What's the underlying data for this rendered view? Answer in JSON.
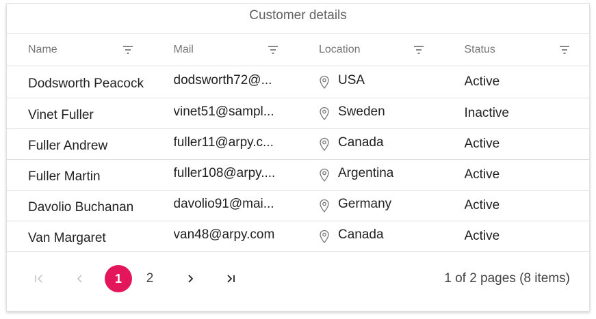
{
  "grid": {
    "title": "Customer details",
    "columns": [
      {
        "label": "Name"
      },
      {
        "label": "Mail"
      },
      {
        "label": "Location"
      },
      {
        "label": "Status"
      }
    ],
    "rows": [
      {
        "name": "Dodsworth Peacock",
        "mail": "dodsworth72@...",
        "location": "USA",
        "status": "Active"
      },
      {
        "name": "Vinet Fuller",
        "mail": "vinet51@sampl...",
        "location": "Sweden",
        "status": "Inactive"
      },
      {
        "name": "Fuller Andrew",
        "mail": "fuller11@arpy.c...",
        "location": "Canada",
        "status": "Active"
      },
      {
        "name": "Fuller Martin",
        "mail": "fuller108@arpy....",
        "location": "Argentina",
        "status": "Active"
      },
      {
        "name": "Davolio Buchanan",
        "mail": "davolio91@mai...",
        "location": "Germany",
        "status": "Active"
      },
      {
        "name": "Van Margaret",
        "mail": "van48@arpy.com",
        "location": "Canada",
        "status": "Active"
      }
    ]
  },
  "pager": {
    "pages": [
      "1",
      "2"
    ],
    "current_page": "1",
    "info": "1 of 2 pages (8 items)",
    "icons": {
      "first": "first-page-icon",
      "prev": "prev-page-icon",
      "next": "next-page-icon",
      "last": "last-page-icon"
    }
  },
  "colors": {
    "accent": "#e3165b",
    "border": "#e0e0e0",
    "header_text": "#757575",
    "body_text": "#212121"
  },
  "icons": {
    "filter": "filter-icon",
    "location": "location-pin-icon"
  }
}
